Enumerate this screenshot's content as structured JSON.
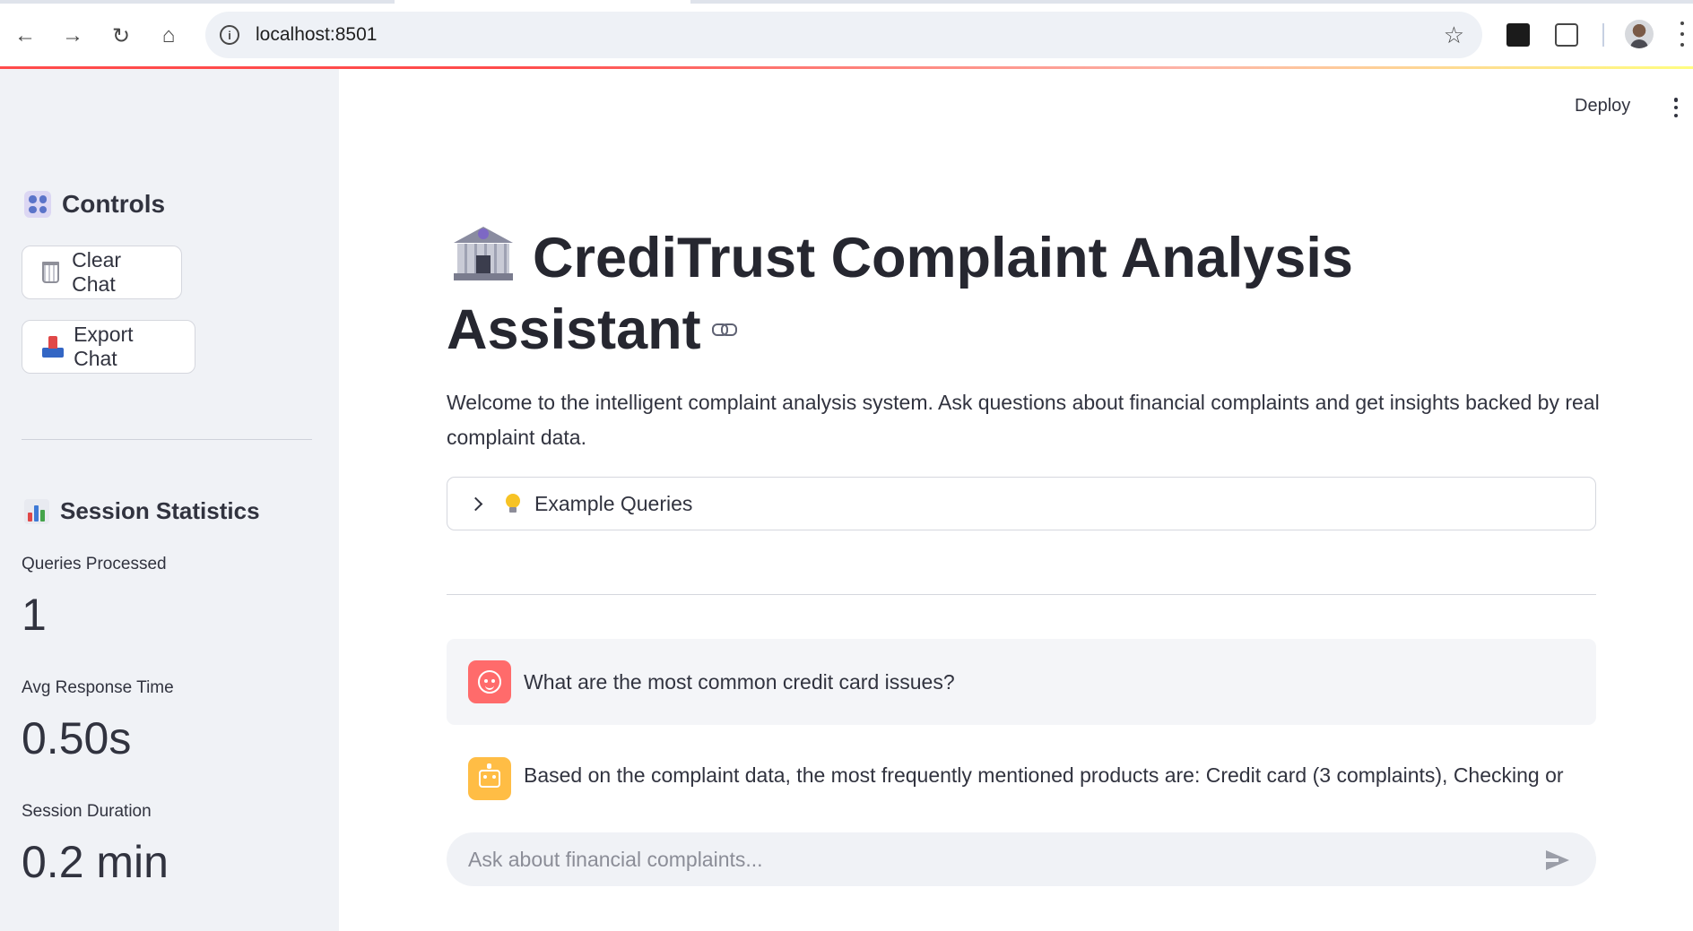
{
  "browser": {
    "url": "localhost:8501"
  },
  "sidebar": {
    "controls_heading": "Controls",
    "clear_chat_label": "Clear Chat",
    "export_chat_label": "Export Chat",
    "stats_heading": "Session Statistics",
    "metrics": [
      {
        "label": "Queries Processed",
        "value": "1"
      },
      {
        "label": "Avg Response Time",
        "value": "0.50s"
      },
      {
        "label": "Session Duration",
        "value": "0.2 min"
      }
    ]
  },
  "header": {
    "deploy_label": "Deploy"
  },
  "main": {
    "title_line1": "CrediTrust Complaint Analysis",
    "title_line2": "Assistant",
    "intro": "Welcome to the intelligent complaint analysis system. Ask questions about financial complaints and get insights backed by real complaint data.",
    "expander_label": "Example Queries",
    "messages": [
      {
        "role": "user",
        "text": "What are the most common credit card issues?"
      },
      {
        "role": "assistant",
        "text": "Based on the complaint data, the most frequently mentioned products are: Credit card (3 complaints), Checking or"
      }
    ],
    "chat_placeholder": "Ask about financial complaints..."
  },
  "colors": {
    "accent": "#ff4b4b",
    "user_avatar": "#ff6b6b",
    "assistant_avatar": "#ffbd45",
    "sidebar_bg": "#f0f2f6"
  },
  "icons": {
    "controls": "control-knobs-icon",
    "clear": "wastebasket-icon",
    "export": "inbox-tray-icon",
    "stats": "bar-chart-icon",
    "title": "bank-icon",
    "expander": "light-bulb-icon"
  }
}
